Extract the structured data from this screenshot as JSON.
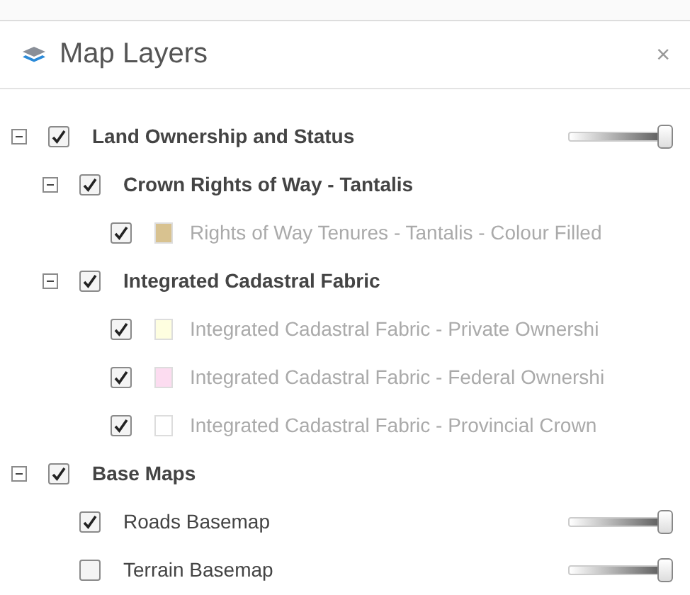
{
  "panel": {
    "title": "Map Layers",
    "close": "×"
  },
  "layers": [
    {
      "kind": "group",
      "label": "Land Ownership and Status",
      "checked": true,
      "expanded": true,
      "level": 1,
      "children": [
        {
          "kind": "group",
          "label": "Crown Rights of Way - Tantalis",
          "checked": true,
          "expanded": true,
          "children": [
            {
              "kind": "layer",
              "label": "Rights of Way Tenures - Tantalis - Colour Filled",
              "checked": true,
              "disabled": true,
              "color": "#d8c290"
            }
          ]
        },
        {
          "kind": "group",
          "label": "Integrated Cadastral Fabric",
          "checked": true,
          "expanded": true,
          "children": [
            {
              "kind": "layer",
              "label": "Integrated Cadastral Fabric - Private Ownershi",
              "checked": true,
              "disabled": true,
              "color": "#fefee0"
            },
            {
              "kind": "layer",
              "label": "Integrated Cadastral Fabric - Federal Ownershi",
              "checked": true,
              "disabled": true,
              "color": "#fcdcf0"
            },
            {
              "kind": "layer",
              "label": "Integrated Cadastral Fabric - Provincial Crown",
              "checked": true,
              "disabled": true,
              "color": "#ffffff"
            }
          ]
        }
      ]
    },
    {
      "kind": "group",
      "label": "Base Maps",
      "checked": true,
      "expanded": true,
      "children": [
        {
          "kind": "layer",
          "label": "Roads Basemap",
          "checked": true,
          "disabled": false,
          "level": 1
        },
        {
          "kind": "layer",
          "label": "Terrain Basemap",
          "checked": false,
          "disabled": false,
          "level": 1
        }
      ]
    }
  ]
}
